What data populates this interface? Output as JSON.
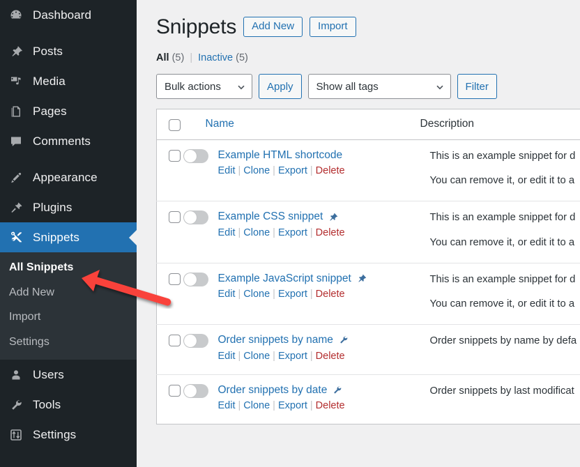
{
  "sidebar": {
    "items": [
      {
        "label": "Dashboard",
        "icon": "dashboard-icon",
        "name": "dashboard"
      },
      {
        "label": "Posts",
        "icon": "pin-icon",
        "name": "posts"
      },
      {
        "label": "Media",
        "icon": "media-icon",
        "name": "media"
      },
      {
        "label": "Pages",
        "icon": "pages-icon",
        "name": "pages"
      },
      {
        "label": "Comments",
        "icon": "comments-icon",
        "name": "comments"
      },
      {
        "label": "Appearance",
        "icon": "brush-icon",
        "name": "appearance"
      },
      {
        "label": "Plugins",
        "icon": "plug-icon",
        "name": "plugins"
      },
      {
        "label": "Snippets",
        "icon": "scissors-icon",
        "name": "snippets"
      },
      {
        "label": "Users",
        "icon": "user-icon",
        "name": "users"
      },
      {
        "label": "Tools",
        "icon": "wrench-icon",
        "name": "tools"
      },
      {
        "label": "Settings",
        "icon": "sliders-icon",
        "name": "settings"
      }
    ],
    "submenu": [
      {
        "label": "All Snippets",
        "name": "all-snippets",
        "current": true
      },
      {
        "label": "Add New",
        "name": "add-new",
        "current": false
      },
      {
        "label": "Import",
        "name": "import",
        "current": false
      },
      {
        "label": "Settings",
        "name": "settings",
        "current": false
      }
    ]
  },
  "header": {
    "title": "Snippets",
    "add_new_label": "Add New",
    "import_label": "Import"
  },
  "views": {
    "all_label": "All",
    "all_count": "(5)",
    "separator": "|",
    "inactive_label": "Inactive",
    "inactive_count": "(5)"
  },
  "toolbar": {
    "bulk_actions_label": "Bulk actions",
    "apply_label": "Apply",
    "tags_label": "Show all tags",
    "filter_label": "Filter"
  },
  "table": {
    "columns": {
      "name": "Name",
      "description": "Description"
    },
    "rows": [
      {
        "name": "Example HTML shortcode",
        "badge": "",
        "enabled": false,
        "desc1": "This is an example snippet for d",
        "desc2": "You can remove it, or edit it to a",
        "actions": {
          "edit": "Edit",
          "clone": "Clone",
          "export": "Export",
          "delete": "Delete"
        }
      },
      {
        "name": "Example CSS snippet",
        "badge": "pin-icon",
        "enabled": false,
        "desc1": "This is an example snippet for d",
        "desc2": "You can remove it, or edit it to a",
        "actions": {
          "edit": "Edit",
          "clone": "Clone",
          "export": "Export",
          "delete": "Delete"
        }
      },
      {
        "name": "Example JavaScript snippet",
        "badge": "pin-icon",
        "enabled": false,
        "desc1": "This is an example snippet for d",
        "desc2": "You can remove it, or edit it to a",
        "actions": {
          "edit": "Edit",
          "clone": "Clone",
          "export": "Export",
          "delete": "Delete"
        }
      },
      {
        "name": "Order snippets by name",
        "badge": "wrench-icon",
        "enabled": false,
        "desc1": "Order snippets by name by defa",
        "desc2": "",
        "actions": {
          "edit": "Edit",
          "clone": "Clone",
          "export": "Export",
          "delete": "Delete"
        }
      },
      {
        "name": "Order snippets by date",
        "badge": "wrench-icon",
        "enabled": false,
        "desc1": "Order snippets by last modificat",
        "desc2": "",
        "actions": {
          "edit": "Edit",
          "clone": "Clone",
          "export": "Export",
          "delete": "Delete"
        }
      }
    ]
  },
  "annotation": {
    "arrow_color": "#f9423a",
    "points_to": "All Snippets"
  },
  "colors": {
    "sidebar_bg": "#1d2327",
    "submenu_bg": "#2c3338",
    "accent_blue": "#2271b1",
    "delete_red": "#b32d2e",
    "page_bg": "#f0f0f1"
  }
}
